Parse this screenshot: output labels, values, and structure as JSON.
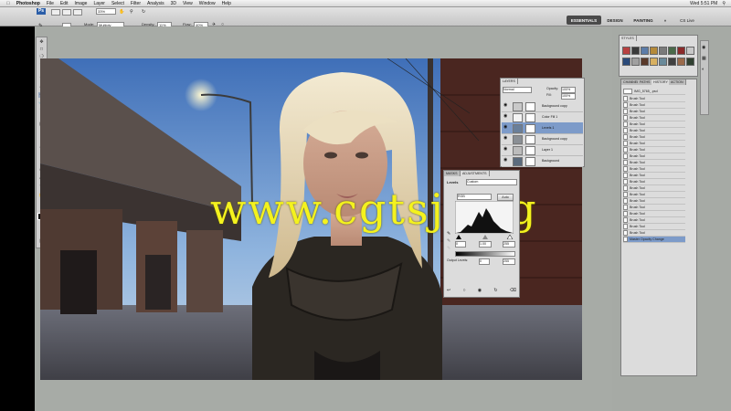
{
  "menubar": {
    "apple_icon": "apple-icon",
    "items": [
      "Photoshop",
      "File",
      "Edit",
      "Image",
      "Layer",
      "Select",
      "Filter",
      "Analysis",
      "3D",
      "View",
      "Window",
      "Help"
    ],
    "clock": "Wed 5:51 PM",
    "search_icon": "spotlight-icon"
  },
  "options": {
    "mode_label": "Mode:",
    "mode_value": "Multiply",
    "density_label": "Density:",
    "density_value": "11%",
    "flow_label": "Flow:",
    "flow_value": "40%",
    "zoom_value": "33%",
    "workspaces": [
      "ESSENTIALS",
      "DESIGN",
      "PAINTING"
    ],
    "cs_live": "CS Live"
  },
  "layers_panel": {
    "tab": "LAYERS",
    "blend_mode": "Normal",
    "opacity_label": "Opacity:",
    "opacity_value": "100%",
    "fill_label": "Fill:",
    "fill_value": "100%",
    "layers": [
      {
        "name": "Background copy",
        "color": "#c9c9c9"
      },
      {
        "name": "Color Fill 1",
        "color": "#f4f4f4"
      },
      {
        "name": "Levels 1",
        "color": "#6a7f9a",
        "selected": true
      },
      {
        "name": "Background copy",
        "color": "#8a8f95"
      },
      {
        "name": "Layer 1",
        "color": "#bcbcbc"
      },
      {
        "name": "Background",
        "color": "#5b6b7d"
      }
    ]
  },
  "adjustments_panel": {
    "tabs": [
      "MASKS",
      "ADJUSTMENTS"
    ],
    "title": "Levels",
    "preset": "Custom",
    "channel": "RGB",
    "auto_label": "Auto",
    "input_low": "0",
    "input_mid": "1.00",
    "input_high": "255",
    "output_label": "Output Levels:",
    "output_low": "0",
    "output_high": "255"
  },
  "styles_panel": {
    "tab": "STYLES",
    "swatches": [
      "#b84040",
      "#3a3a3a",
      "#5c7ca8",
      "#b48a3a",
      "#7a7a7a",
      "#4a6a4a",
      "#8a2a2a",
      "#c8c8c8",
      "#2a4a7a",
      "#a0a0a0",
      "#5a3a2a",
      "#d8b060",
      "#6a8a9a",
      "#404040",
      "#9a6a4a",
      "#304030"
    ]
  },
  "history_panel": {
    "tabs": [
      "CHANNEL",
      "PATHS",
      "HISTORY",
      "ACTION"
    ],
    "snapshot": "IMG_5765_.psd",
    "step_label": "Brush Tool",
    "step_count": 22,
    "last_step": "Master Opacity Change"
  },
  "toolbox": {
    "tools": [
      "move-tool-icon",
      "marquee-tool-icon",
      "lasso-tool-icon",
      "quick-select-tool-icon",
      "crop-tool-icon",
      "eyedropper-tool-icon",
      "healing-brush-icon",
      "brush-tool-icon",
      "clone-stamp-icon",
      "history-brush-icon",
      "eraser-tool-icon",
      "gradient-tool-icon",
      "blur-tool-icon",
      "dodge-tool-icon",
      "pen-tool-icon",
      "type-tool-icon",
      "path-select-icon",
      "shape-tool-icon",
      "3d-rotate-icon",
      "3d-orbit-icon",
      "hand-tool-icon",
      "zoom-tool-icon"
    ]
  },
  "watermark": "www.cgtsj.org"
}
